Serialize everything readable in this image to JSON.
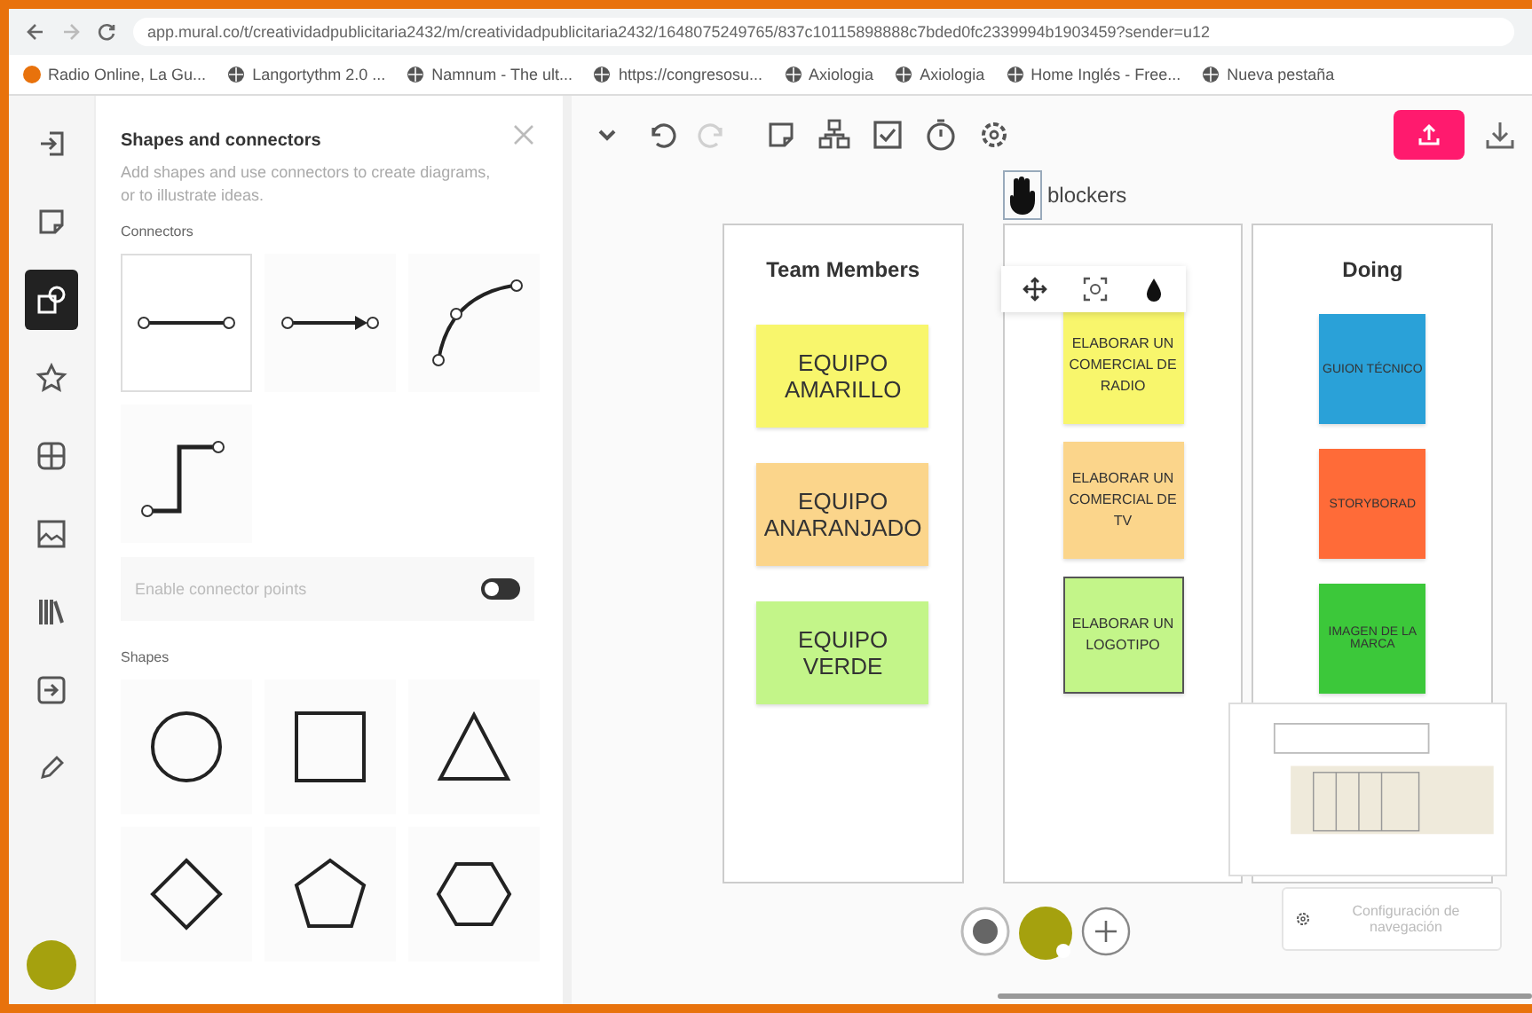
{
  "browser": {
    "url": "app.mural.co/t/creatividadpublicitaria2432/m/creatividadpublicitaria2432/1648075249765/837c10115898888c7bded0fc2339994b1903459?sender=u12",
    "bookmarks": [
      {
        "label": "Radio Online, La Gu..."
      },
      {
        "label": "Langortythm 2.0 ..."
      },
      {
        "label": "Namnum - The ult..."
      },
      {
        "label": "https://congresosu..."
      },
      {
        "label": "Axiologia"
      },
      {
        "label": "Axiologia"
      },
      {
        "label": "Home Inglés - Free..."
      },
      {
        "label": "Nueva pestaña"
      }
    ]
  },
  "rail": {
    "items": [
      {
        "kind": "exit",
        "selected": false
      },
      {
        "kind": "note",
        "selected": false
      },
      {
        "kind": "shapes",
        "selected": true
      },
      {
        "kind": "star",
        "selected": false
      },
      {
        "kind": "grid",
        "selected": false
      },
      {
        "kind": "image",
        "selected": false
      },
      {
        "kind": "library",
        "selected": false
      },
      {
        "kind": "import",
        "selected": false
      },
      {
        "kind": "pencil",
        "selected": false
      }
    ]
  },
  "panel": {
    "title": "Shapes and connectors",
    "description": "Add shapes and use connectors to create diagrams, or to illustrate ideas.",
    "connectors_heading": "Connectors",
    "connectors": [
      {
        "kind": "straight",
        "selected": true
      },
      {
        "kind": "arrow",
        "selected": false
      },
      {
        "kind": "curved",
        "selected": false
      },
      {
        "kind": "elbow",
        "selected": false
      }
    ],
    "connector_points": {
      "label": "Enable connector points",
      "on": false
    },
    "shapes_heading": "Shapes",
    "shapes": [
      {
        "kind": "circle"
      },
      {
        "kind": "square"
      },
      {
        "kind": "triangle"
      },
      {
        "kind": "diamond"
      },
      {
        "kind": "pentagon"
      },
      {
        "kind": "hexagon"
      }
    ]
  },
  "toolbar": {
    "tools": [
      {
        "kind": "chevron",
        "disabled": false
      },
      {
        "kind": "undo",
        "disabled": false
      },
      {
        "kind": "redo",
        "disabled": true
      },
      {
        "kind": "note",
        "disabled": false
      },
      {
        "kind": "network",
        "disabled": false
      },
      {
        "kind": "checkbox",
        "disabled": false
      },
      {
        "kind": "timer",
        "disabled": false
      },
      {
        "kind": "settings",
        "disabled": false
      }
    ]
  },
  "canvas": {
    "label": "blockers",
    "columns": [
      {
        "title": "Team Members",
        "notes": [
          {
            "text": "EQUIPO AMARILLO",
            "color": "#f8f66c",
            "selected": false
          },
          {
            "text": "EQUIPO ANARANJADO",
            "color": "#fbd58b",
            "selected": false
          },
          {
            "text": "EQUIPO VERDE",
            "color": "#c3f589",
            "selected": false
          }
        ]
      },
      {
        "notes": [
          {
            "text": "ELABORAR UN COMERCIAL DE RADIO",
            "color": "#f8f66c",
            "selected": false
          },
          {
            "text": "ELABORAR UN COMERCIAL DE TV",
            "color": "#fbd58b",
            "selected": false
          },
          {
            "text": "ELABORAR UN LOGOTIPO",
            "color": "#c3f589",
            "selected": true
          }
        ]
      },
      {
        "title": "Doing",
        "notes": [
          {
            "text": "GUION TÉCNICO",
            "color": "#2aa1d8",
            "selected": false
          },
          {
            "text": "STORYBORAD",
            "color": "#ff6b38",
            "selected": false
          },
          {
            "text": "IMAGEN DE LA MARCA",
            "color": "#3cc83a",
            "selected": false
          }
        ]
      }
    ]
  },
  "navigation_settings": "Configuración de navegación"
}
